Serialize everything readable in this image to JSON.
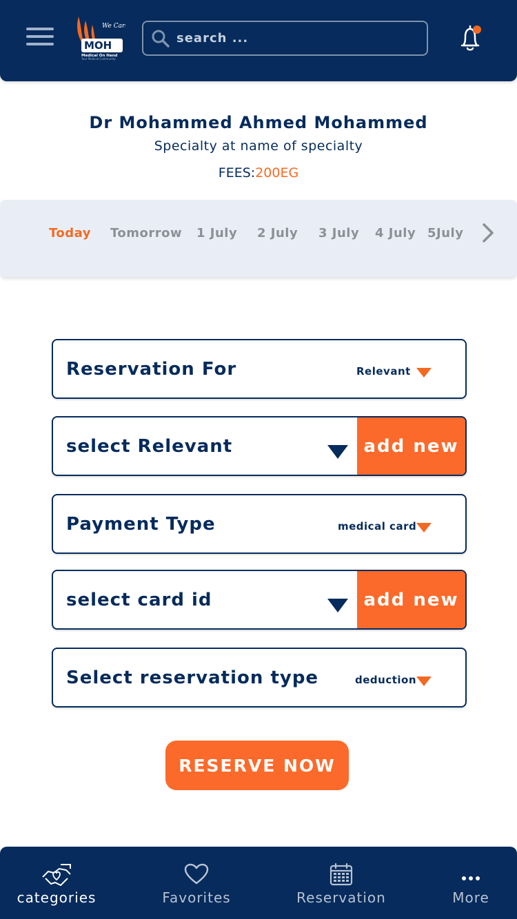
{
  "header": {
    "search_placeholder": "search ...",
    "logo": {
      "tagline": "We Care",
      "brand": "MOH",
      "subtitle": "Medical On Hand",
      "slogan": "Your Medical Community"
    }
  },
  "doctor": {
    "name": "Dr Mohammed Ahmed Mohammed",
    "specialty": "Specialty at name of specialty",
    "fees_label": "FEES:",
    "fees_value": "200EG"
  },
  "dates": {
    "items": [
      "Today",
      "Tomorrow",
      "1 July",
      "2 July",
      "3 July",
      "4 July",
      "5July"
    ],
    "active_index": 0
  },
  "form": {
    "reservation_for": {
      "label": "Reservation For",
      "value": "Relevant"
    },
    "relevant": {
      "label": "select Relevant",
      "add_label": "add new"
    },
    "payment": {
      "label": "Payment Type",
      "value": "medical card"
    },
    "card": {
      "label": "select card id",
      "add_label": "add new"
    },
    "reservation_type": {
      "label": "Select reservation type",
      "value": "deduction"
    }
  },
  "reserve_button": "RESERVE NOW",
  "bottom_nav": [
    {
      "label": "categories",
      "icon": "handshake-heart-icon",
      "active": true
    },
    {
      "label": "Favorites",
      "icon": "heart-icon",
      "active": false
    },
    {
      "label": "Reservation",
      "icon": "calendar-icon",
      "active": false
    },
    {
      "label": "More",
      "icon": "more-dots-icon",
      "active": false
    }
  ],
  "colors": {
    "navy": "#062b5c",
    "orange": "#fb6a2a",
    "date_bar": "#e9eef6"
  }
}
